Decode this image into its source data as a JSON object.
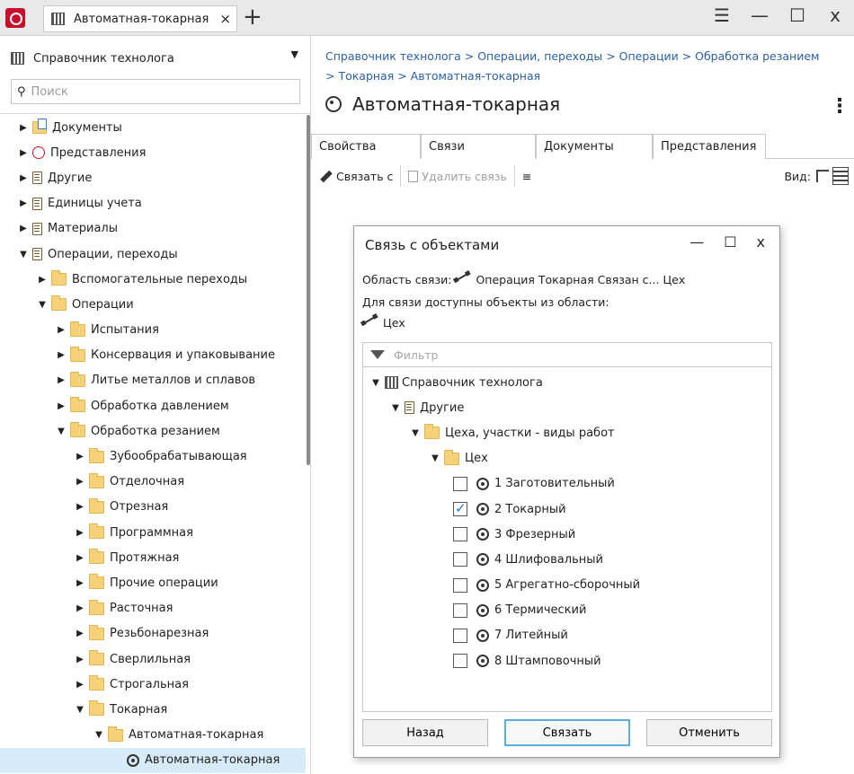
{
  "window": {
    "tab_title": "Автоматная-токарная",
    "tab_close": "×",
    "new_tab": "+",
    "menu": "☰",
    "minimize": "—",
    "maximize": "☐",
    "close": "x"
  },
  "sidebar": {
    "library": "Справочник технолога",
    "search_placeholder": "Поиск",
    "tree": [
      {
        "label": "Документы",
        "level": 0,
        "state": "collapsed",
        "icon": "docs"
      },
      {
        "label": "Представления",
        "level": 0,
        "state": "collapsed",
        "icon": "view"
      },
      {
        "label": "Другие",
        "level": 0,
        "state": "collapsed",
        "icon": "book"
      },
      {
        "label": "Единицы учета",
        "level": 0,
        "state": "collapsed",
        "icon": "book"
      },
      {
        "label": "Материалы",
        "level": 0,
        "state": "collapsed",
        "icon": "book"
      },
      {
        "label": "Операции, переходы",
        "level": 0,
        "state": "expanded",
        "icon": "book"
      },
      {
        "label": "Вспомогательные переходы",
        "level": 1,
        "state": "collapsed",
        "icon": "folder"
      },
      {
        "label": "Операции",
        "level": 1,
        "state": "expanded",
        "icon": "folder"
      },
      {
        "label": "Испытания",
        "level": 2,
        "state": "collapsed",
        "icon": "folder"
      },
      {
        "label": "Консервация и упаковывание",
        "level": 2,
        "state": "collapsed",
        "icon": "folder"
      },
      {
        "label": "Литье металлов и сплавов",
        "level": 2,
        "state": "collapsed",
        "icon": "folder"
      },
      {
        "label": "Обработка давлением",
        "level": 2,
        "state": "collapsed",
        "icon": "folder"
      },
      {
        "label": "Обработка резанием",
        "level": 2,
        "state": "expanded",
        "icon": "folder"
      },
      {
        "label": "Зубообрабатывающая",
        "level": 3,
        "state": "collapsed",
        "icon": "folder"
      },
      {
        "label": "Отделочная",
        "level": 3,
        "state": "collapsed",
        "icon": "folder"
      },
      {
        "label": "Отрезная",
        "level": 3,
        "state": "collapsed",
        "icon": "folder"
      },
      {
        "label": "Программная",
        "level": 3,
        "state": "collapsed",
        "icon": "folder"
      },
      {
        "label": "Протяжная",
        "level": 3,
        "state": "collapsed",
        "icon": "folder"
      },
      {
        "label": "Прочие операции",
        "level": 3,
        "state": "collapsed",
        "icon": "folder"
      },
      {
        "label": "Расточная",
        "level": 3,
        "state": "collapsed",
        "icon": "folder"
      },
      {
        "label": "Резьбонарезная",
        "level": 3,
        "state": "collapsed",
        "icon": "folder"
      },
      {
        "label": "Сверлильная",
        "level": 3,
        "state": "collapsed",
        "icon": "folder"
      },
      {
        "label": "Строгальная",
        "level": 3,
        "state": "collapsed",
        "icon": "folder"
      },
      {
        "label": "Токарная",
        "level": 3,
        "state": "expanded",
        "icon": "folder"
      },
      {
        "label": "Автоматная-токарная",
        "level": 4,
        "state": "expanded",
        "icon": "folder"
      },
      {
        "label": "Автоматная-токарная",
        "level": 5,
        "state": "leaf",
        "icon": "gear",
        "selected": true
      }
    ]
  },
  "main": {
    "breadcrumb_line1": "Справочник технолога > Операции, переходы > Операции > Обработка резанием",
    "breadcrumb_line2": "> Токарная > Автоматная-токарная",
    "title": "Автоматная-токарная",
    "more": "⋮",
    "tabs": [
      "Свойства",
      "Связи",
      "Документы",
      "Представления"
    ],
    "active_tab": 1,
    "toolbar": {
      "link": "Связать с",
      "unlink": "Удалить связь",
      "view_label": "Вид:"
    }
  },
  "dialog": {
    "title": "Связь с объектами",
    "minimize": "—",
    "maximize": "☐",
    "close": "x",
    "scope_label": "Область связи:",
    "scope_value": "Операция Токарная Связан с... Цех",
    "available_label": "Для связи доступны объекты из области:",
    "available_value": "Цех",
    "filter_placeholder": "Фильтр",
    "tree": [
      {
        "label": "Справочник технолога",
        "level": 0,
        "icon": "library",
        "state": "expanded"
      },
      {
        "label": "Другие",
        "level": 1,
        "icon": "book",
        "state": "expanded"
      },
      {
        "label": "Цеха, участки - виды работ",
        "level": 2,
        "icon": "folder",
        "state": "expanded"
      },
      {
        "label": "Цех",
        "level": 3,
        "icon": "folder",
        "state": "expanded"
      }
    ],
    "items": [
      {
        "label": "1 Заготовительный",
        "checked": false
      },
      {
        "label": "2 Токарный",
        "checked": true
      },
      {
        "label": "3 Фрезерный",
        "checked": false
      },
      {
        "label": "4 Шлифовальный",
        "checked": false
      },
      {
        "label": "5 Агрегатно-сборочный",
        "checked": false
      },
      {
        "label": "6 Термический",
        "checked": false
      },
      {
        "label": "7 Литейный",
        "checked": false
      },
      {
        "label": "8 Штамповочный",
        "checked": false
      }
    ],
    "buttons": {
      "back": "Назад",
      "link": "Связать",
      "cancel": "Отменить"
    }
  }
}
